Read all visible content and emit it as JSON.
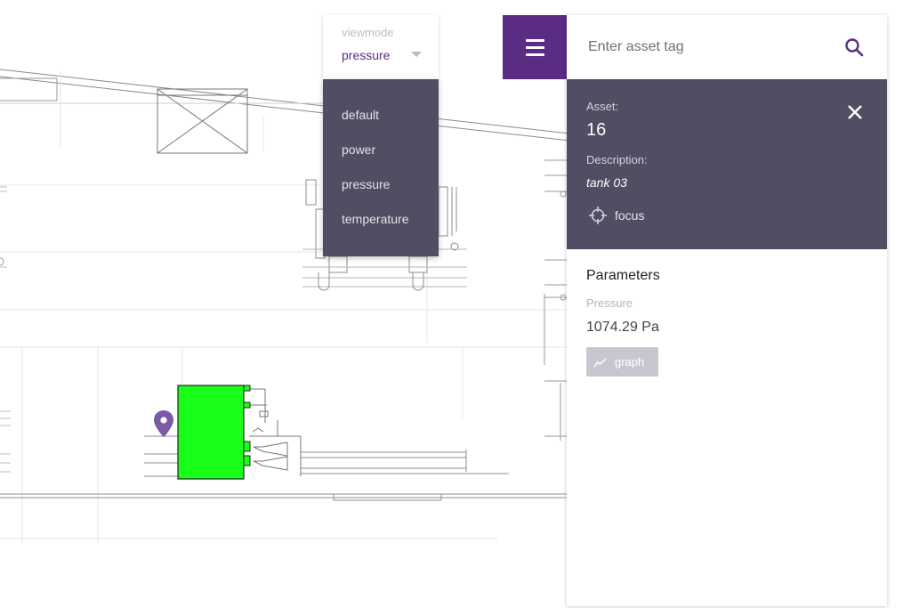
{
  "viewmode": {
    "label": "viewmode",
    "selected": "pressure",
    "options": [
      "default",
      "power",
      "pressure",
      "temperature"
    ]
  },
  "search": {
    "placeholder": "Enter asset tag"
  },
  "asset": {
    "asset_label": "Asset:",
    "id": "16",
    "description_label": "Description:",
    "description": "tank 03",
    "focus_label": "focus"
  },
  "parameters": {
    "title": "Parameters",
    "items": [
      {
        "name": "Pressure",
        "value": "1074.29 Pa"
      }
    ],
    "graph_label": "graph"
  },
  "colors": {
    "brand": "#5b2c83",
    "panel_dark": "#4f4e62",
    "asset_highlight": "#1aff1a",
    "marker": "#7b5aa6"
  },
  "icons": {
    "menu": "menu-icon",
    "search": "search-icon",
    "close": "close-icon",
    "focus": "crosshair-icon",
    "graph": "trend-line-icon",
    "marker": "map-pin-icon"
  }
}
